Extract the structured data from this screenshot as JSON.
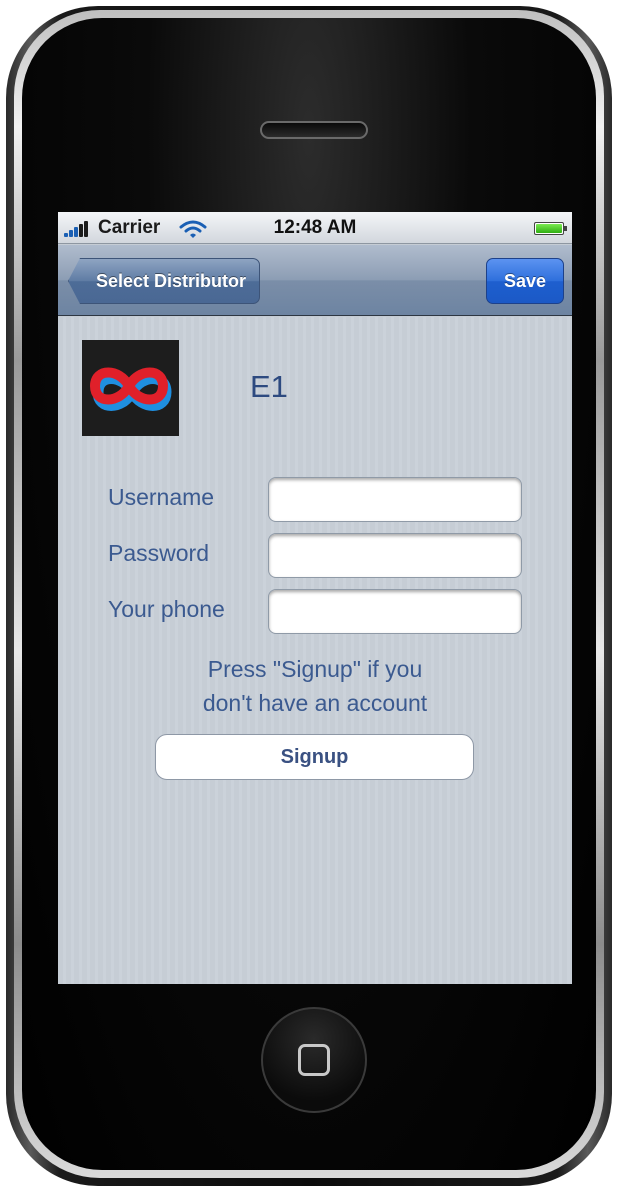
{
  "status_bar": {
    "carrier": "Carrier",
    "time": "12:48 AM",
    "signal_icon": "signal-bars-icon",
    "wifi_icon": "wifi-icon",
    "battery_icon": "battery-icon",
    "battery_level": 1.0
  },
  "nav_bar": {
    "back_label": "Select Distributor",
    "save_label": "Save"
  },
  "distributor": {
    "name": "E1",
    "logo_icon": "infinity-logo-icon"
  },
  "form": {
    "username_label": "Username",
    "username_value": "",
    "password_label": "Password",
    "password_value": "",
    "phone_label": "Your phone",
    "phone_value": ""
  },
  "hint": {
    "line1": "Press \"Signup\" if you",
    "line2": "don't have an account"
  },
  "signup_label": "Signup",
  "colors": {
    "accent": "#1e5fcf",
    "navbar": "#8c9db4",
    "label_text": "#3b5a90",
    "logo_red": "#e0202a",
    "logo_blue": "#1f8fe0"
  }
}
